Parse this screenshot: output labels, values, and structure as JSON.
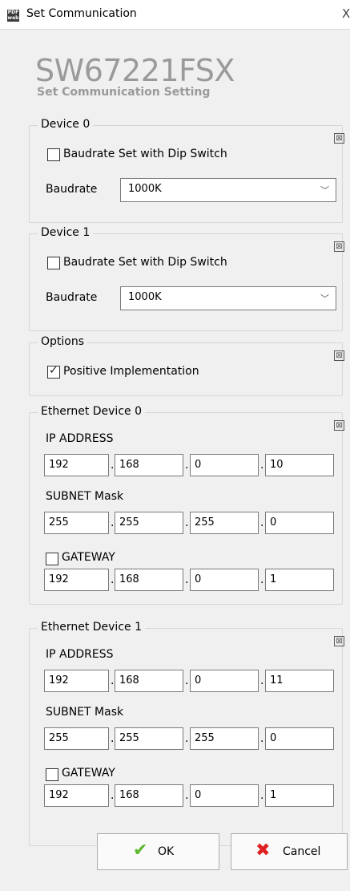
{
  "window": {
    "icon_text": "PDF web",
    "title": "Set Communication",
    "close_glyph": "X"
  },
  "header": {
    "product": "SW67221FSX",
    "subtitle": "Set Communication Setting"
  },
  "device0": {
    "legend": "Device 0",
    "dip_label": "Baudrate Set with Dip Switch",
    "dip_checked": false,
    "baudrate_label": "Baudrate",
    "baudrate_value": "1000K"
  },
  "device1": {
    "legend": "Device 1",
    "dip_label": "Baudrate Set with Dip Switch",
    "dip_checked": false,
    "baudrate_label": "Baudrate",
    "baudrate_value": "1000K"
  },
  "options": {
    "legend": "Options",
    "positive_label": "Positive Implementation",
    "positive_checked": true
  },
  "eth0": {
    "legend": "Ethernet Device 0",
    "ip_label": "IP ADDRESS",
    "ip": [
      "192",
      "168",
      "0",
      "10"
    ],
    "mask_label": "SUBNET Mask",
    "mask": [
      "255",
      "255",
      "255",
      "0"
    ],
    "gw_label": "GATEWAY",
    "gw_checked": false,
    "gw": [
      "192",
      "168",
      "0",
      "1"
    ]
  },
  "eth1": {
    "legend": "Ethernet Device 1",
    "ip_label": "IP ADDRESS",
    "ip": [
      "192",
      "168",
      "0",
      "11"
    ],
    "mask_label": "SUBNET Mask",
    "mask": [
      "255",
      "255",
      "255",
      "0"
    ],
    "gw_label": "GATEWAY",
    "gw_checked": false,
    "gw": [
      "192",
      "168",
      "0",
      "1"
    ]
  },
  "buttons": {
    "ok": "OK",
    "cancel": "Cancel"
  },
  "glyphs": {
    "collapse": "⊠",
    "dropdown": "﹀",
    "check": "✔",
    "cross": "✖"
  },
  "colors": {
    "ok_icon": "#5cb82e",
    "cancel_icon": "#e02020",
    "title_gray": "#9a9a9a"
  }
}
